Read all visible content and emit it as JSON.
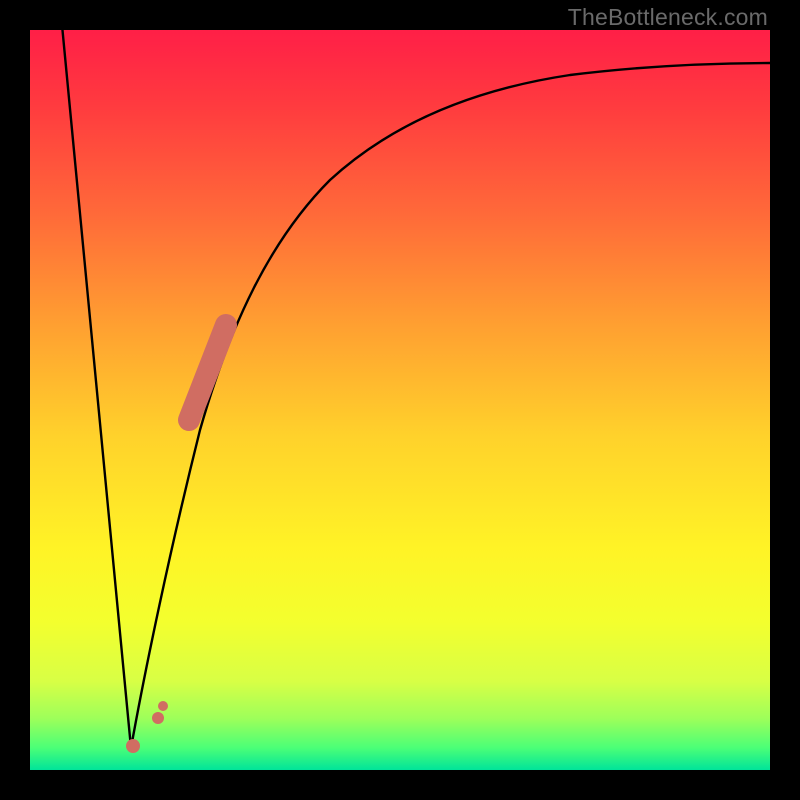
{
  "attribution": "TheBottleneck.com",
  "colors": {
    "frame": "#000000",
    "curve_stroke": "#000000",
    "marker_fill": "#d06d62",
    "gradient_top": "#ff1f47",
    "gradient_bottom": "#00e49a"
  },
  "chart_data": {
    "type": "line",
    "title": "",
    "xlabel": "",
    "ylabel": "",
    "xlim": [
      0,
      100
    ],
    "ylim": [
      0,
      100
    ],
    "series": [
      {
        "name": "left-branch",
        "x": [
          4,
          6,
          8,
          10,
          12,
          13.7
        ],
        "y": [
          100,
          80,
          60,
          40,
          20,
          3
        ]
      },
      {
        "name": "right-branch",
        "x": [
          13.7,
          15,
          17,
          20,
          23,
          27,
          32,
          38,
          45,
          55,
          70,
          85,
          100
        ],
        "y": [
          3,
          12,
          25,
          40,
          51,
          61,
          70,
          77,
          82,
          86,
          90,
          92.5,
          94
        ]
      }
    ],
    "markers": [
      {
        "name": "highlight-segment",
        "shape": "thick-line",
        "x": [
          21.5,
          26.5
        ],
        "y": [
          47,
          60
        ]
      },
      {
        "name": "minimum-dot",
        "shape": "dot",
        "x": [
          13.7,
          17.5
        ],
        "y": [
          3,
          7
        ]
      }
    ]
  }
}
